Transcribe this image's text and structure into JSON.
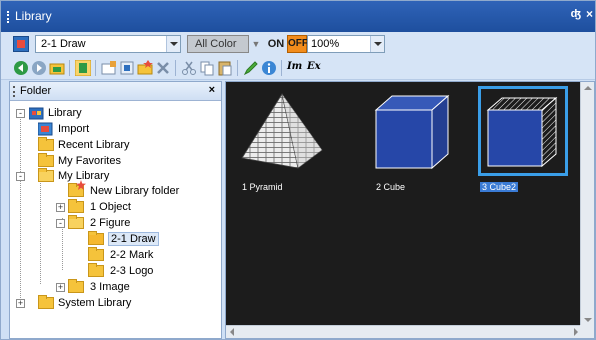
{
  "window": {
    "title": "Library",
    "pin_glyph": "%A4",
    "close_glyph": "×"
  },
  "toolbar": {
    "library_icon": "library-icon",
    "folder_select_value": "2-1 Draw",
    "color_button": "All Color",
    "on_label": "ON",
    "off_label": "OFF",
    "zoom_value": "100%",
    "icons": [
      "back-arrow-icon",
      "forward-arrow-icon",
      "open-folder-icon",
      "view-icon",
      "library-add-icon",
      "library-edit-icon",
      "library-new-icon",
      "delete-icon",
      "cut-icon",
      "copy-icon",
      "paste-icon",
      "pencil-icon",
      "info-icon",
      "import-icon",
      "export-icon"
    ],
    "import_label": "Im",
    "export_label": "Ex"
  },
  "folder_panel": {
    "title": "Folder",
    "close_glyph": "×",
    "tree": [
      {
        "label": "Library",
        "level": 0,
        "icon": "library-icon",
        "expander": "-"
      },
      {
        "label": "Import",
        "level": 1,
        "icon": "import-icon"
      },
      {
        "label": "Recent Library",
        "level": 1,
        "icon": "folder-icon"
      },
      {
        "label": "My Favorites",
        "level": 1,
        "icon": "folder-icon"
      },
      {
        "label": "My Library",
        "level": 1,
        "icon": "folder-open-icon",
        "expander": "-"
      },
      {
        "label": "New Library folder",
        "level": 2,
        "icon": "new-folder-icon"
      },
      {
        "label": "1 Object",
        "level": 2,
        "icon": "folder-icon",
        "expander": "+"
      },
      {
        "label": "2 Figure",
        "level": 2,
        "icon": "folder-open-icon",
        "expander": "-"
      },
      {
        "label": "2-1 Draw",
        "level": 3,
        "icon": "folder-open-icon",
        "selected": true
      },
      {
        "label": "2-2 Mark",
        "level": 3,
        "icon": "folder-icon"
      },
      {
        "label": "2-3 Logo",
        "level": 3,
        "icon": "folder-icon"
      },
      {
        "label": "3 Image",
        "level": 2,
        "icon": "folder-icon",
        "expander": "+"
      },
      {
        "label": "System Library",
        "level": 1,
        "icon": "folder-icon",
        "expander": "+"
      }
    ]
  },
  "thumbnails": [
    {
      "label": "1 Pyramid",
      "shape": "pyramid"
    },
    {
      "label": "2 Cube",
      "shape": "cube"
    },
    {
      "label": "3 Cube2",
      "shape": "cube-hatched",
      "selected": true
    }
  ],
  "colors": {
    "titlebar": "#2a5caf",
    "thumbnail_background": "#1c1c1c",
    "cube_face": "#2647a8",
    "selection": "#3a9ee8",
    "off_button": "#f28c1c"
  }
}
